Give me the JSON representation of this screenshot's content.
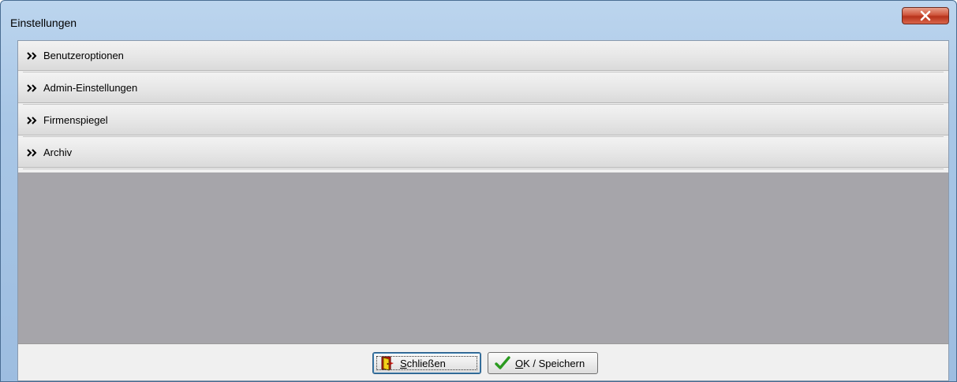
{
  "window": {
    "title": "Einstellungen",
    "close_glyph": "X"
  },
  "sections": [
    {
      "label": "Benutzeroptionen",
      "icon": "double-chevron-right-icon"
    },
    {
      "label": "Admin-Einstellungen",
      "icon": "double-chevron-right-icon"
    },
    {
      "label": "Firmenspiegel",
      "icon": "double-chevron-right-icon"
    },
    {
      "label": "Archiv",
      "icon": "double-chevron-right-icon"
    }
  ],
  "footer": {
    "close_button": {
      "mnemonic": "S",
      "rest": "chließen",
      "icon": "exit-door-icon"
    },
    "ok_button": {
      "mnemonic": "O",
      "rest": "K / Speichern",
      "icon": "checkmark-icon"
    }
  },
  "colors": {
    "titlebar": "#a9c7e6",
    "close_button": "#c94a32",
    "panel_gray": "#a6a5aa",
    "checkmark": "#2a9a1f",
    "door_red": "#c8140c",
    "door_yellow": "#f3d21a"
  }
}
